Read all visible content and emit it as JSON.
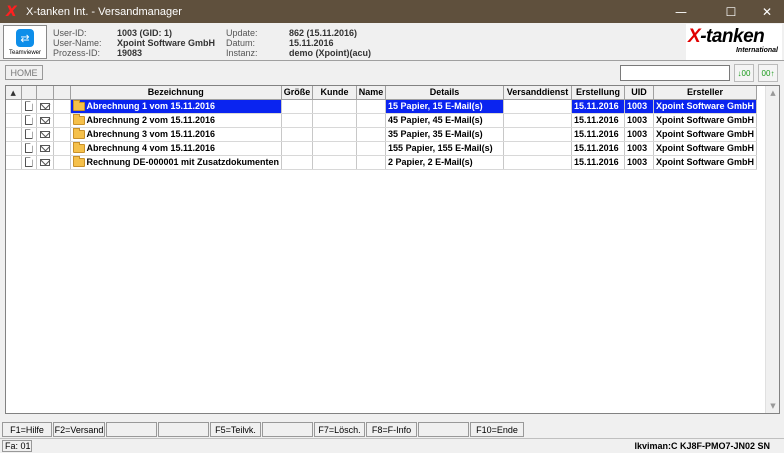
{
  "window": {
    "title": "X-tanken Int. - Versandmanager",
    "app_icon": "X",
    "minimize": "—",
    "maximize": "☐",
    "close": "✕"
  },
  "teamviewer": {
    "label": "Teamviewer",
    "icon": "⇄"
  },
  "info": {
    "user_id_label": "User-ID:",
    "user_id": "1003 (GID: 1)",
    "user_name_label": "User-Name:",
    "user_name": "Xpoint Software GmbH",
    "process_id_label": "Prozess-ID:",
    "process_id": "19083",
    "update_label": "Update:",
    "update": "862 (15.11.2016)",
    "date_label": "Datum:",
    "date": "15.11.2016",
    "instance_label": "Instanz:",
    "instance": "demo (Xpoint)(acu)"
  },
  "brand": {
    "name_x": "X",
    "name_rest": "-tanken",
    "sub": "International"
  },
  "toolbar": {
    "home_label": "HOME",
    "search_value": "",
    "btn1_label": "↓00",
    "btn2_label": "00↑"
  },
  "table": {
    "sort_icon": "▲",
    "columns": [
      "Bezeichnung",
      "Größe",
      "Kunde",
      "Name",
      "Details",
      "Versanddienst",
      "Erstellung",
      "UID",
      "Ersteller"
    ],
    "rows": [
      {
        "bezeichnung": "Abrechnung 1 vom 15.11.2016",
        "groesse": "",
        "kunde": "",
        "name": "",
        "details": "15 Papier, 15 E-Mail(s)",
        "versanddienst": "",
        "erstellung": "15.11.2016",
        "uid": "1003",
        "ersteller": "Xpoint Software GmbH"
      },
      {
        "bezeichnung": "Abrechnung 2 vom 15.11.2016",
        "groesse": "",
        "kunde": "",
        "name": "",
        "details": "45 Papier, 45 E-Mail(s)",
        "versanddienst": "",
        "erstellung": "15.11.2016",
        "uid": "1003",
        "ersteller": "Xpoint Software GmbH"
      },
      {
        "bezeichnung": "Abrechnung 3 vom 15.11.2016",
        "groesse": "",
        "kunde": "",
        "name": "",
        "details": "35 Papier, 35 E-Mail(s)",
        "versanddienst": "",
        "erstellung": "15.11.2016",
        "uid": "1003",
        "ersteller": "Xpoint Software GmbH"
      },
      {
        "bezeichnung": "Abrechnung 4 vom 15.11.2016",
        "groesse": "",
        "kunde": "",
        "name": "",
        "details": "155 Papier, 155 E-Mail(s)",
        "versanddienst": "",
        "erstellung": "15.11.2016",
        "uid": "1003",
        "ersteller": "Xpoint Software GmbH"
      },
      {
        "bezeichnung": "Rechnung DE-000001 mit Zusatzdokumenten",
        "groesse": "",
        "kunde": "",
        "name": "",
        "details": "2 Papier, 2 E-Mail(s)",
        "versanddienst": "",
        "erstellung": "15.11.2016",
        "uid": "1003",
        "ersteller": "Xpoint Software GmbH"
      }
    ]
  },
  "scrollbar": {
    "up": "▲",
    "down": "▼"
  },
  "fkeys": [
    "F1=Hilfe",
    "F2=Versand",
    "",
    "",
    "F5=Teilvk.",
    "",
    "F7=Lösch.",
    "F8=F-Info",
    "",
    "F10=Ende"
  ],
  "status": {
    "left": "Fa: 01",
    "right": "lkviman:C KJ8F-PMO7-JN02 SN"
  }
}
